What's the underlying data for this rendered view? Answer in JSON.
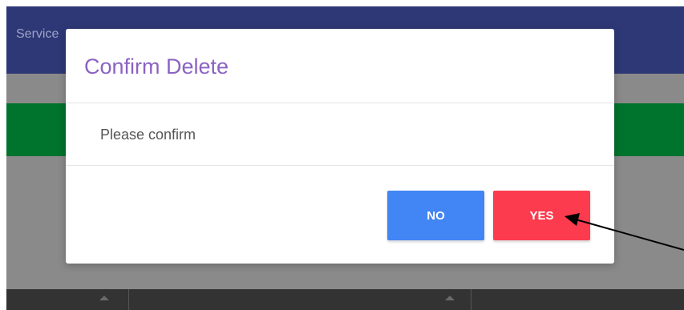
{
  "background": {
    "nav_label": "Service",
    "colors": {
      "nav": "#2e3876",
      "overlay": "#8a8a8a",
      "green_bar": "#00732d",
      "table_header": "#333333"
    }
  },
  "dialog": {
    "title": "Confirm Delete",
    "message": "Please confirm",
    "buttons": {
      "no_label": "NO",
      "yes_label": "YES"
    },
    "colors": {
      "title": "#8b63c2",
      "no_button": "#4285f4",
      "yes_button": "#fc3b4e"
    }
  },
  "annotation": {
    "icon": "pointer-arrow",
    "color": "#000000"
  }
}
